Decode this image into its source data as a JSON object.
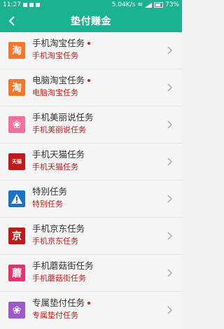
{
  "status_bar": {
    "time": "11:27",
    "speed": "5.04K/s",
    "battery": "73%"
  },
  "header": {
    "title": "垫付赚金",
    "back_icon": "chevron-left-icon"
  },
  "items": [
    {
      "title": "手机淘宝任务",
      "subtitle": "手机淘宝任务",
      "dot": true,
      "icon_char": "淘",
      "icon_color": "#f4762a"
    },
    {
      "title": "电脑淘宝任务",
      "subtitle": "电脑淘宝任务",
      "dot": true,
      "icon_char": "淘",
      "icon_color": "#f4762a"
    },
    {
      "title": "手机美丽说任务",
      "subtitle": "手机美丽说任务",
      "dot": false,
      "icon_char": "❀",
      "icon_color": "#f2709a"
    },
    {
      "title": "手机天猫任务",
      "subtitle": "手机天猫任务",
      "dot": false,
      "icon_char": "天猫",
      "icon_color": "#c4191a"
    },
    {
      "title": "特别任务",
      "subtitle": "特别任务",
      "dot": false,
      "icon_char": "!",
      "icon_color": "#1a73c6"
    },
    {
      "title": "手机京东任务",
      "subtitle": "手机京东任务",
      "dot": false,
      "icon_char": "京",
      "icon_color": "#c4191a"
    },
    {
      "title": "手机蘑菇街任务",
      "subtitle": "手机蘑菇街任务",
      "dot": false,
      "icon_char": "蘑",
      "icon_color": "#e8336a"
    },
    {
      "title": "专属垫付任务",
      "subtitle": "专属垫付任务",
      "dot": true,
      "icon_char": "❀",
      "icon_color": "#9b59c9"
    }
  ],
  "colors": {
    "brand": "#1bb291",
    "subtitle": "#c0201e",
    "dot": "#d0211c"
  }
}
